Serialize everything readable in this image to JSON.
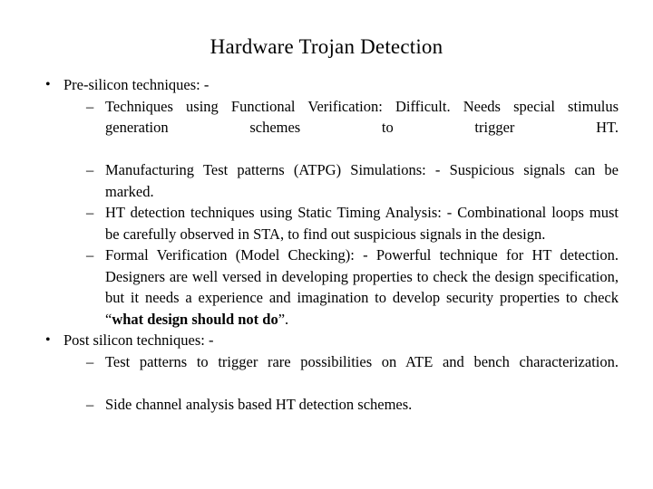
{
  "slide": {
    "title": "Hardware Trojan Detection",
    "background_color": "#ffffff",
    "text_color": "#000000",
    "bullet_marker": "•",
    "dash_marker": "–",
    "sections": [
      {
        "heading": "Pre-silicon techniques: -",
        "items": [
          "Techniques using Functional Verification: Difficult. Needs special stimulus generation schemes to trigger HT.",
          "Manufacturing Test patterns (ATPG) Simulations: - Suspicious signals can be marked.",
          "HT detection techniques using Static Timing Analysis: - Combinational loops must be carefully observed in STA, to find out suspicious signals in the design.",
          "Formal Verification (Model Checking): - Powerful technique for HT detection. Designers are well versed in developing properties to check the design specification, but it needs a experience and imagination to develop security properties to check "
        ],
        "item4_quote_prefix": "“",
        "item4_quote_bold": "what design should not do",
        "item4_quote_suffix": "”."
      },
      {
        "heading": "Post silicon techniques: -",
        "items": [
          "Test patterns to trigger rare possibilities on ATE and bench characterization.",
          "Side channel analysis based HT detection schemes."
        ]
      }
    ]
  }
}
